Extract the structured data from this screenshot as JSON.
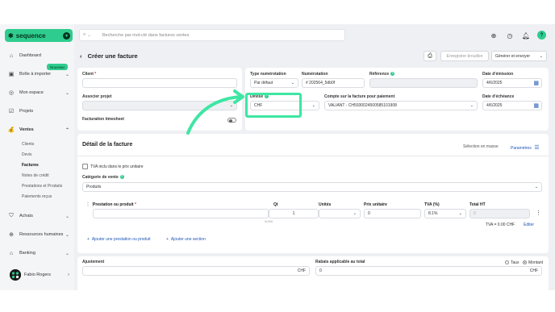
{
  "brand": {
    "name": "sequence"
  },
  "sidebar": {
    "items": [
      {
        "label": "Dashboard",
        "icon": "home-icon"
      },
      {
        "label": "Boîte à importer",
        "icon": "inbox-icon"
      },
      {
        "label": "Mon espace",
        "icon": "compass-icon"
      },
      {
        "label": "Projets",
        "icon": "check-square-icon"
      },
      {
        "label": "Ventes",
        "icon": "money-bag-icon"
      },
      {
        "label": "Achats",
        "icon": "shopping-bag-icon"
      },
      {
        "label": "Ressources humaines",
        "icon": "globe-icon"
      },
      {
        "label": "Banking",
        "icon": "bank-icon"
      }
    ],
    "badge_new": "Nouveau",
    "sub_items": [
      "Clients",
      "Devis",
      "Factures",
      "Notes de crédit",
      "Prestations et Produits",
      "Paiements reçus"
    ],
    "user_name": "Fabio Rogers"
  },
  "topbar": {
    "search_placeholder": "Recherche par mot-clé dans factures ventes",
    "help": "?"
  },
  "header": {
    "back": "‹",
    "title": "Créer une facture",
    "draft_button": "Enregistrer brouillon",
    "send_button": "Générer et envoyer"
  },
  "form": {
    "client_label": "Client",
    "project_label": "Associer projet",
    "timesheet_label": "Facturation timesheet",
    "numbering_type_label": "Type numérotation",
    "numbering_type_value": "Par défaut",
    "numbering_label": "Numérotation",
    "numbering_value": "# 202564_5db0f",
    "reference_label": "Référence",
    "issue_date_label": "Date d'émission",
    "issue_date_value": "4/6/2025",
    "currency_label": "Devise",
    "currency_value": "CHF",
    "account_label": "Compte sur la facture pour paiement",
    "account_value": "VALIANT - CH5930024500585101908",
    "due_date_label": "Date d'échéance",
    "due_date_value": "4/6/2025"
  },
  "details": {
    "title": "Détail de la facture",
    "mass_select": "Sélection en masse",
    "params": "Paramètres",
    "tva_included": "TVA inclu dans le prix unitaire",
    "category_label": "Catégorie de vente",
    "category_value": "Produits",
    "columns": {
      "product": "Prestation ou produit",
      "qty": "Qt",
      "units": "Unités",
      "unit_price": "Prix unitaire",
      "tva": "TVA (%)",
      "total": "Total HT"
    },
    "row": {
      "qty": "1",
      "qty_note": "0/250",
      "unit_price": "0",
      "tva": "8.1%",
      "total": "0"
    },
    "tva_total": "TVA = 0.00 CHF",
    "edit": "Editer",
    "add_item": "Ajouter une prestation ou produit",
    "add_section": "Ajouter une section"
  },
  "footer": {
    "adjust_label": "Ajustement",
    "adjust_currency": "CHF",
    "discount_label": "Rabais applicable au total",
    "discount_value": "0",
    "discount_currency": "CHF",
    "radio_rate": "Taux",
    "radio_amount": "Montant"
  },
  "colors": {
    "accent": "#2ecc8e",
    "highlight": "#3ee6a3",
    "link": "#1f56b5"
  }
}
